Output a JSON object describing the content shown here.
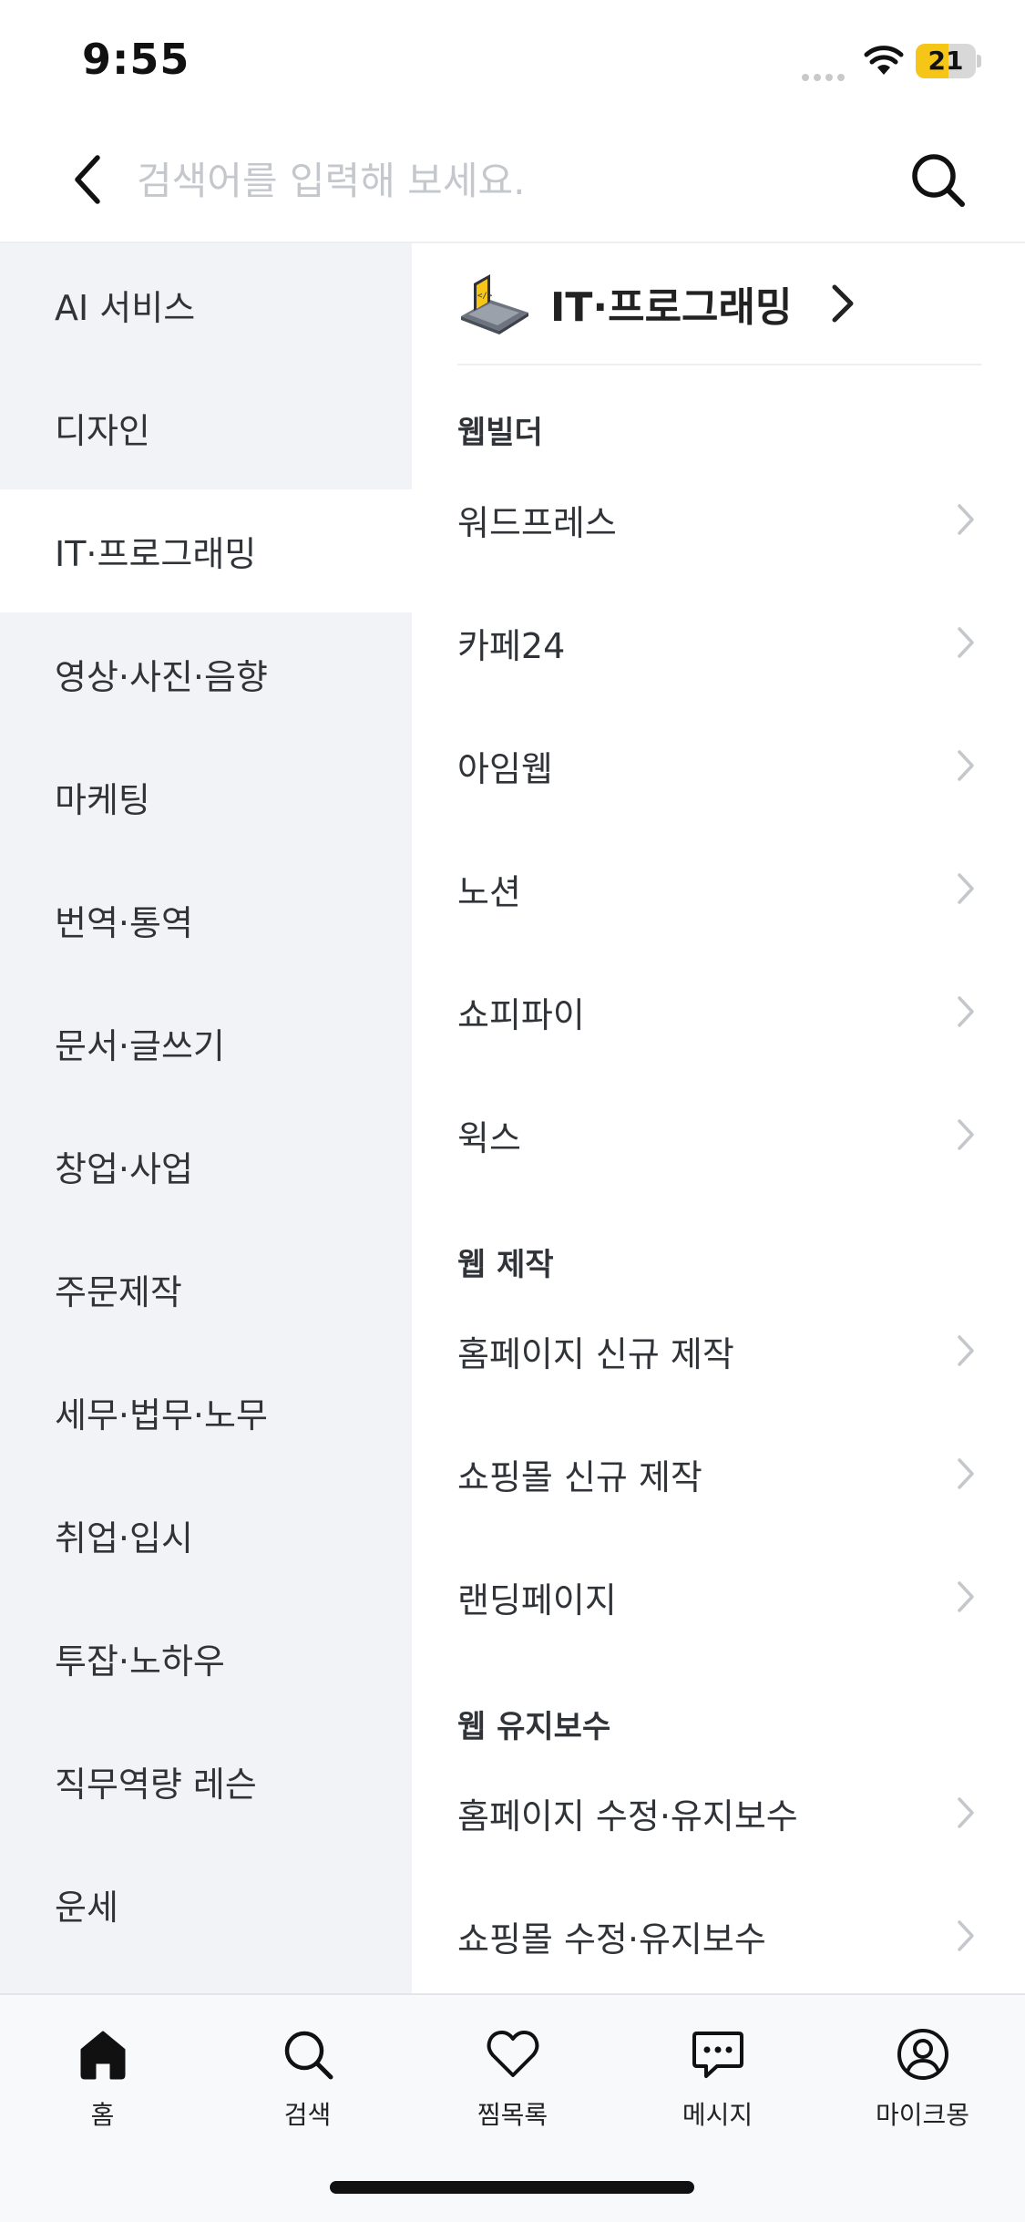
{
  "status_bar": {
    "time": "9:55",
    "battery": "21",
    "battery_level": 0.21,
    "battery_color": "#f5c518"
  },
  "search": {
    "placeholder": "검색어를 입력해 보세요."
  },
  "left_menu": [
    {
      "label": "AI 서비스",
      "active": false
    },
    {
      "label": "디자인",
      "active": false
    },
    {
      "label": "IT·프로그래밍",
      "active": true
    },
    {
      "label": "영상·사진·음향",
      "active": false
    },
    {
      "label": "마케팅",
      "active": false
    },
    {
      "label": "번역·통역",
      "active": false
    },
    {
      "label": "문서·글쓰기",
      "active": false
    },
    {
      "label": "창업·사업",
      "active": false
    },
    {
      "label": "주문제작",
      "active": false
    },
    {
      "label": "세무·법무·노무",
      "active": false
    },
    {
      "label": "취업·입시",
      "active": false
    },
    {
      "label": "투잡·노하우",
      "active": false
    },
    {
      "label": "직무역량 레슨",
      "active": false
    },
    {
      "label": "운세",
      "active": false
    }
  ],
  "category": {
    "title": "IT·프로그래밍",
    "icon": "laptop-code-icon",
    "sections": [
      {
        "title": "웹빌더",
        "items": [
          "워드프레스",
          "카페24",
          "아임웹",
          "노션",
          "쇼피파이",
          "윅스"
        ]
      },
      {
        "title": "웹 제작",
        "items": [
          "홈페이지 신규 제작",
          "쇼핑몰 신규 제작",
          "랜딩페이지"
        ]
      },
      {
        "title": "웹 유지보수",
        "items": [
          "홈페이지 수정·유지보수",
          "쇼핑몰 수정·유지보수"
        ]
      }
    ]
  },
  "tabs": [
    {
      "label": "홈",
      "icon": "home-icon",
      "active": true
    },
    {
      "label": "검색",
      "icon": "search-icon",
      "active": false
    },
    {
      "label": "찜목록",
      "icon": "heart-icon",
      "active": false
    },
    {
      "label": "메시지",
      "icon": "message-icon",
      "active": false
    },
    {
      "label": "마이크몽",
      "icon": "profile-icon",
      "active": false
    }
  ],
  "colors": {
    "left_bg": "#f2f3f7",
    "text": "#303338",
    "active_item_bg": "#ffffff",
    "chevron": "#c4c7cc"
  }
}
